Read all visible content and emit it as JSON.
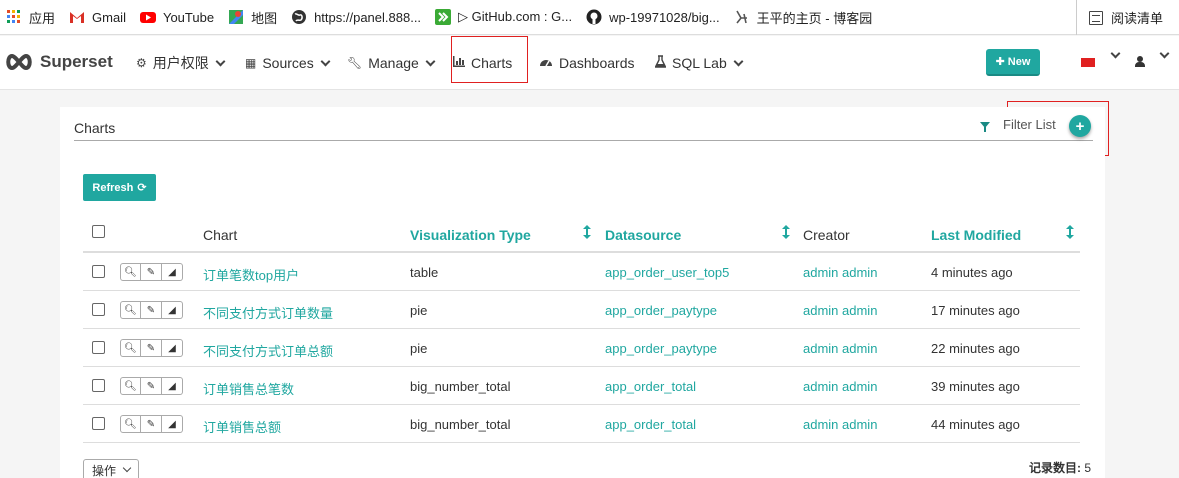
{
  "bookmarks": [
    {
      "label": "应用",
      "icon": "apps-grid-icon",
      "color": "#e34c26"
    },
    {
      "label": "Gmail",
      "icon": "gmail-icon",
      "color": "#d93025"
    },
    {
      "label": "YouTube",
      "icon": "youtube-icon",
      "color": "#ff0000"
    },
    {
      "label": "地图",
      "icon": "maps-icon",
      "color": "#34a853"
    },
    {
      "label": "https://panel.888...",
      "icon": "globe-icon",
      "color": "#333333"
    },
    {
      "label": "▷ GitHub.com : G...",
      "icon": "forward-icon",
      "color": "#3aaa35"
    },
    {
      "label": "wp-19971028/big...",
      "icon": "github-icon",
      "color": "#222222"
    },
    {
      "label": "王平的主页 - 博客园",
      "icon": "cnblogs-icon",
      "color": "#555555"
    }
  ],
  "reading_list": "阅读清单",
  "navbar": {
    "brand": "Superset",
    "items": [
      {
        "label": "用户权限",
        "icon": "cogs-icon",
        "dropdown": true
      },
      {
        "label": "Sources",
        "icon": "table-icon",
        "dropdown": true
      },
      {
        "label": "Manage",
        "icon": "wrench-icon",
        "dropdown": true
      },
      {
        "label": "Charts",
        "icon": "bar-chart-icon",
        "dropdown": false
      },
      {
        "label": "Dashboards",
        "icon": "dashboard-icon",
        "dropdown": false
      },
      {
        "label": "SQL Lab",
        "icon": "flask-icon",
        "dropdown": true
      }
    ],
    "new_button": "New",
    "accent": "#20a7a0"
  },
  "panel": {
    "title": "Charts",
    "filter_label": "Filter List",
    "refresh_label": "Refresh",
    "columns": {
      "chart": "Chart",
      "viz_type": "Visualization Type",
      "datasource": "Datasource",
      "creator": "Creator",
      "last_modified": "Last Modified"
    },
    "rows": [
      {
        "chart": "订单笔数top用户",
        "viz_type": "table",
        "datasource": "app_order_user_top5",
        "creator": "admin admin",
        "modified": "4 minutes ago"
      },
      {
        "chart": "不同支付方式订单数量",
        "viz_type": "pie",
        "datasource": "app_order_paytype",
        "creator": "admin admin",
        "modified": "17 minutes ago"
      },
      {
        "chart": "不同支付方式订单总额",
        "viz_type": "pie",
        "datasource": "app_order_paytype",
        "creator": "admin admin",
        "modified": "22 minutes ago"
      },
      {
        "chart": "订单销售总笔数",
        "viz_type": "big_number_total",
        "datasource": "app_order_total",
        "creator": "admin admin",
        "modified": "39 minutes ago"
      },
      {
        "chart": "订单销售总额",
        "viz_type": "big_number_total",
        "datasource": "app_order_total",
        "creator": "admin admin",
        "modified": "44 minutes ago"
      }
    ],
    "bulk_actions": "操作",
    "record_count_label": "记录数目:",
    "record_count": "5"
  }
}
